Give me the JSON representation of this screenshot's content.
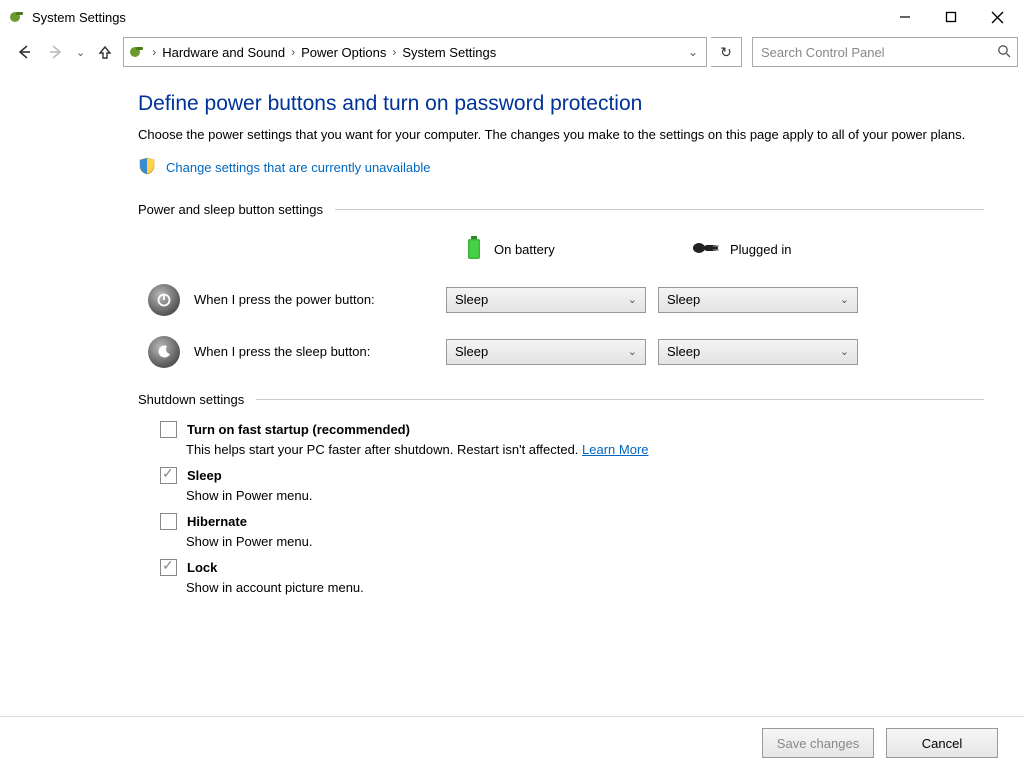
{
  "window": {
    "title": "System Settings"
  },
  "breadcrumb": {
    "items": [
      "Hardware and Sound",
      "Power Options",
      "System Settings"
    ]
  },
  "search": {
    "placeholder": "Search Control Panel"
  },
  "heading": "Define power buttons and turn on password protection",
  "description": "Choose the power settings that you want for your computer. The changes you make to the settings on this page apply to all of your power plans.",
  "change_link": "Change settings that are currently unavailable",
  "sections": {
    "power_sleep": "Power and sleep button settings",
    "shutdown": "Shutdown settings"
  },
  "columns": {
    "battery": "On battery",
    "plugged": "Plugged in"
  },
  "rows": {
    "power_button": {
      "label": "When I press the power button:",
      "battery": "Sleep",
      "plugged": "Sleep"
    },
    "sleep_button": {
      "label": "When I press the sleep button:",
      "battery": "Sleep",
      "plugged": "Sleep"
    }
  },
  "shutdown": {
    "fast_startup": {
      "title": "Turn on fast startup (recommended)",
      "sub_prefix": "This helps start your PC faster after shutdown. Restart isn't affected. ",
      "learn_more": "Learn More",
      "checked": false
    },
    "sleep": {
      "title": "Sleep",
      "sub": "Show in Power menu.",
      "checked": true
    },
    "hibernate": {
      "title": "Hibernate",
      "sub": "Show in Power menu.",
      "checked": false
    },
    "lock": {
      "title": "Lock",
      "sub": "Show in account picture menu.",
      "checked": true
    }
  },
  "footer": {
    "save": "Save changes",
    "cancel": "Cancel"
  }
}
